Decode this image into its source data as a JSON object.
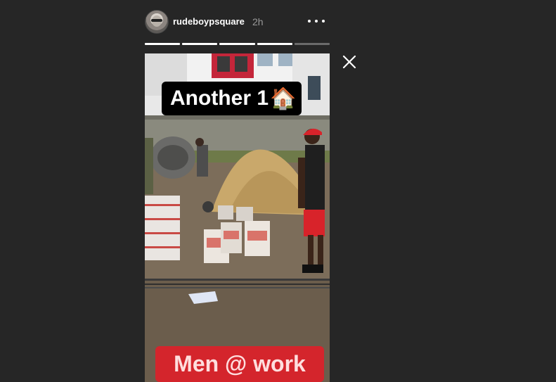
{
  "header": {
    "username": "rudeboypsquare",
    "time": "2h",
    "more_icon": "more-horizontal-icon",
    "avatar_icon": "profile-avatar"
  },
  "progress": {
    "segments_total": 5,
    "segments_viewed": 4
  },
  "close_icon": "close-icon",
  "story": {
    "sticker_top": "Another 1",
    "sticker_top_emoji": "🏠",
    "sticker_bottom": "Men @ work"
  },
  "colors": {
    "background": "#262626",
    "sticker_bottom_bg": "#d4252c",
    "sticker_top_bg": "#000000"
  }
}
